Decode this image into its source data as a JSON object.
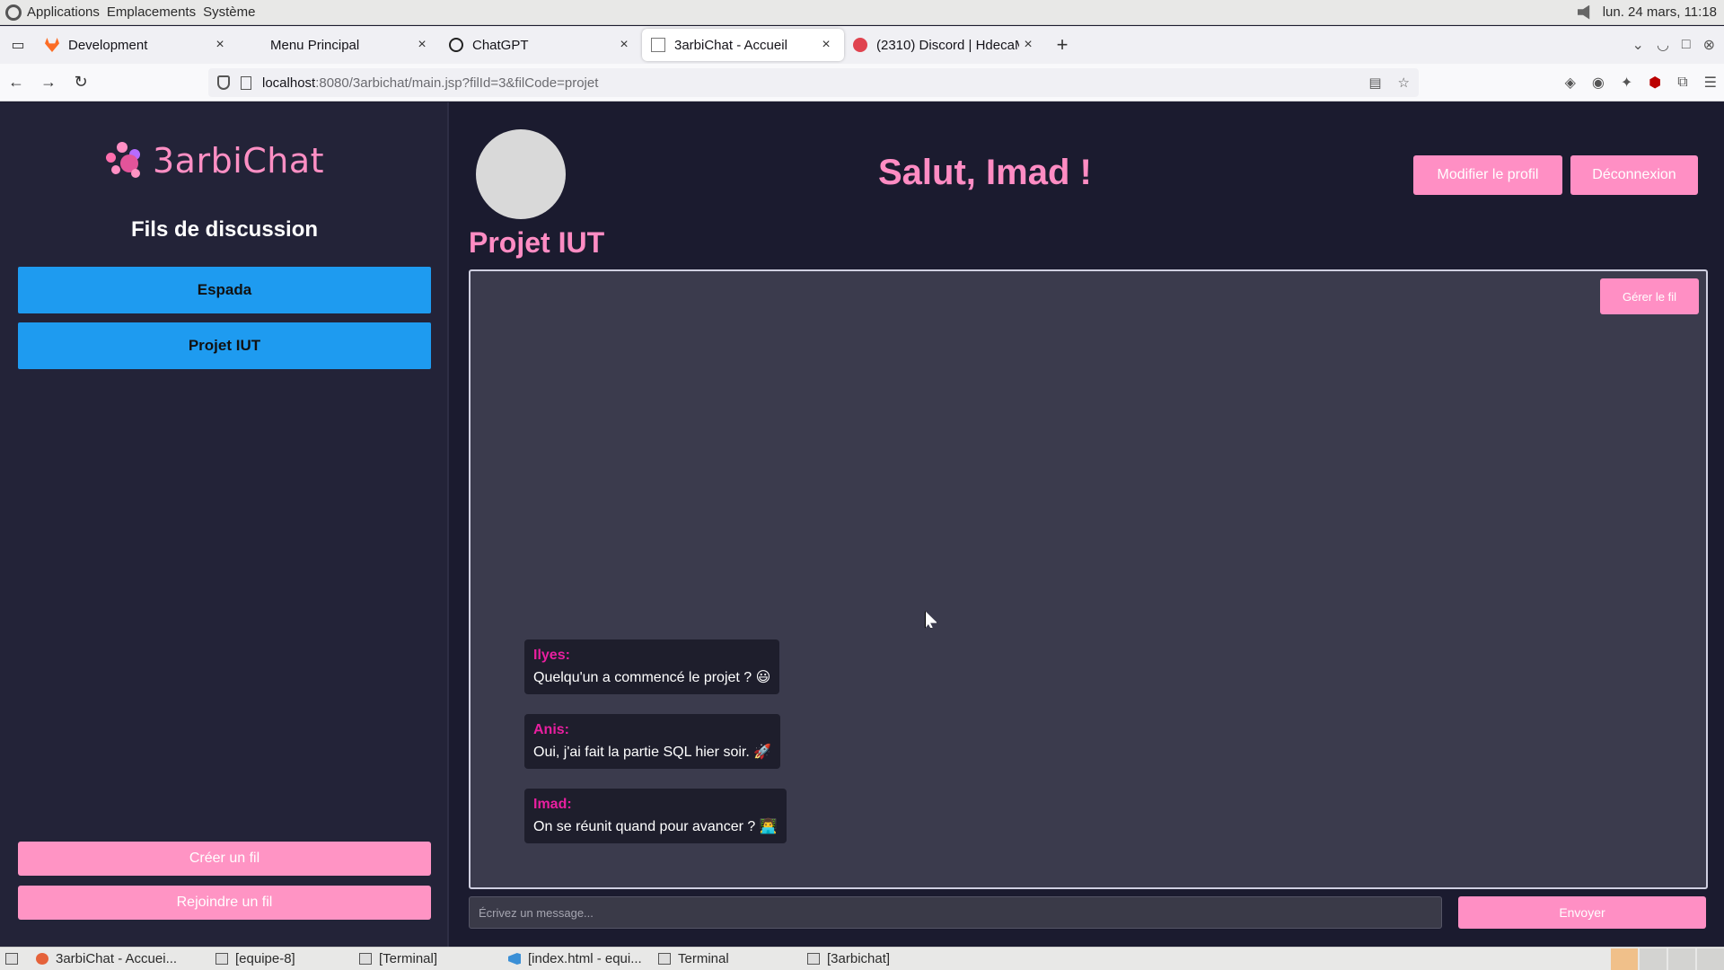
{
  "os_top": {
    "menus": [
      "Applications",
      "Emplacements",
      "Système"
    ],
    "clock": "lun. 24 mars, 11:18"
  },
  "browser": {
    "tabs": [
      {
        "title": "Development",
        "icon": "gitlab-icon"
      },
      {
        "title": "Menu Principal",
        "icon": ""
      },
      {
        "title": "ChatGPT",
        "icon": "chatgpt-icon"
      },
      {
        "title": "3arbiChat - Accueil",
        "icon": "page-icon"
      },
      {
        "title": "(2310) Discord | HdecaM, ",
        "icon": "discord-icon"
      }
    ],
    "url_host": "localhost",
    "url_path": ":8080/3arbichat/main.jsp?filId=3&filCode=projet"
  },
  "sidebar": {
    "brand": "3arbiChat",
    "section_title": "Fils de discussion",
    "threads": [
      "Espada",
      "Projet IUT"
    ],
    "create_label": "Créer un fil",
    "join_label": "Rejoindre un fil"
  },
  "main": {
    "greeting": "Salut, Imad !",
    "edit_profile_label": "Modifier le profil",
    "logout_label": "Déconnexion",
    "thread_title": "Projet IUT",
    "manage_label": "Gérer le fil",
    "messages": [
      {
        "author": "Ilyes:",
        "text": "Quelqu'un a commencé le projet ? 😃"
      },
      {
        "author": "Anis:",
        "text": "Oui, j'ai fait la partie SQL hier soir. 🚀"
      },
      {
        "author": "Imad:",
        "text": "On se réunit quand pour avancer ? 👨‍💻"
      }
    ],
    "compose_placeholder": "Écrivez un message...",
    "send_label": "Envoyer"
  },
  "taskbar": {
    "items": [
      "3arbiChat - Accuei...",
      "[equipe-8]",
      "[Terminal]",
      "[index.html - equi...",
      "Terminal",
      "[3arbichat]"
    ]
  },
  "colors": {
    "accent_pink": "#ff8fc4",
    "thread_blue": "#1e9bf0",
    "author_magenta": "#e91fa0",
    "background": "#1b1b2f"
  }
}
